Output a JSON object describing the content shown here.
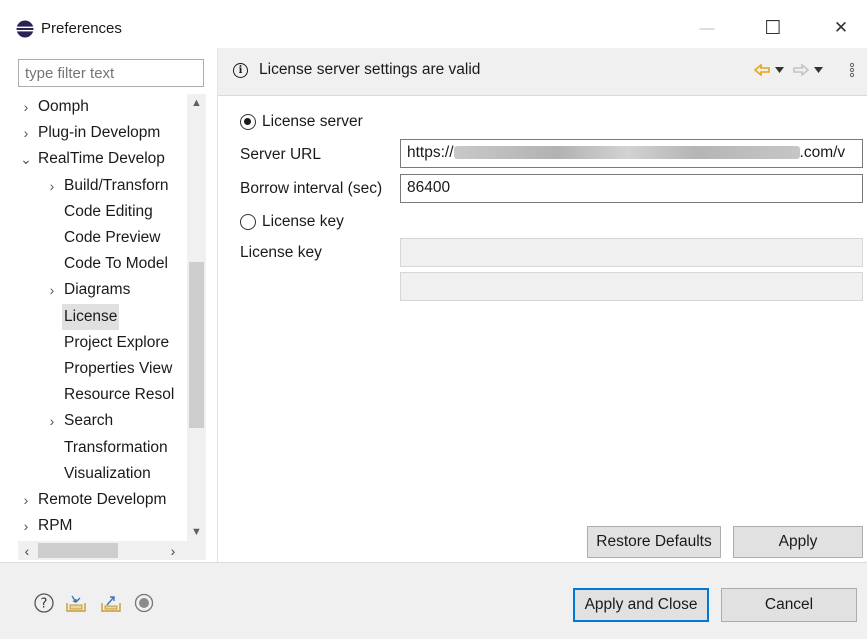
{
  "window": {
    "title": "Preferences",
    "minimize_glyph": "—",
    "maximize_glyph": "☐",
    "close_glyph": "✕"
  },
  "filter": {
    "placeholder": "type filter text"
  },
  "tree": {
    "items": [
      {
        "label": "Oomph",
        "twisty": "›"
      },
      {
        "label": "Plug-in Developm",
        "twisty": "›"
      },
      {
        "label": "RealTime Develop",
        "twisty": "⌄"
      },
      {
        "label": "Build/Transforn",
        "twisty": "›"
      },
      {
        "label": "Code Editing",
        "twisty": ""
      },
      {
        "label": "Code Preview",
        "twisty": ""
      },
      {
        "label": "Code To Model",
        "twisty": ""
      },
      {
        "label": "Diagrams",
        "twisty": "›"
      },
      {
        "label": "License",
        "twisty": ""
      },
      {
        "label": "Project Explore",
        "twisty": ""
      },
      {
        "label": "Properties View",
        "twisty": ""
      },
      {
        "label": "Resource Resol",
        "twisty": ""
      },
      {
        "label": "Search",
        "twisty": "›"
      },
      {
        "label": "Transformation",
        "twisty": ""
      },
      {
        "label": "Visualization",
        "twisty": ""
      },
      {
        "label": "Remote Developm",
        "twisty": "›"
      },
      {
        "label": "RPM",
        "twisty": "›"
      }
    ],
    "selected": "License"
  },
  "header": {
    "message": "License server settings are valid",
    "info_icon": "info-icon"
  },
  "form": {
    "license_server_label": "License server",
    "server_url_label": "Server URL",
    "server_url_prefix": "https://",
    "server_url_suffix": ".com/v",
    "borrow_label": "Borrow interval (sec)",
    "borrow_value": "86400",
    "license_key_radio": "License key",
    "license_key_label": "License key",
    "selected_mode": "License server"
  },
  "buttons": {
    "restore_defaults": "Restore Defaults",
    "apply": "Apply",
    "apply_and_close": "Apply and Close",
    "cancel": "Cancel"
  },
  "colors": {
    "accent": "#0078d7",
    "nav_arrow": "#e8a317"
  }
}
